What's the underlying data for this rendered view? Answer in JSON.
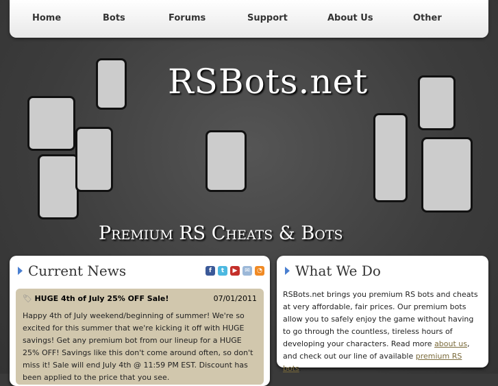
{
  "nav": [
    "Home",
    "Bots",
    "Forums",
    "Support",
    "About Us",
    "Other"
  ],
  "banner": {
    "logo": "RSBots.net",
    "tagline": "Premium RS Cheats & Bots"
  },
  "news": {
    "title": "Current News",
    "social": [
      "facebook-icon",
      "twitter-icon",
      "youtube-icon",
      "email-icon",
      "rss-icon"
    ],
    "item": {
      "title": "HUGE 4th of July 25% OFF Sale!",
      "date": "07/01/2011",
      "body": "Happy 4th of July weekend/beginning of summer! We're so excited for this summer that we're kicking it off with HUGE savings! Get any premium bot from our lineup for a HUGE 25% OFF! Savings like this don't come around often, so don't miss it! Sale will end July 4th @ 11:59 PM EST. Discount has been applied to the price that you see."
    }
  },
  "what": {
    "title": "What We Do",
    "text1": "RSBots.net brings you premium RS bots and cheats at very affordable, fair prices. Our premium bots allow you to safely enjoy the game without having to go through the countless, tireless hours of developing your characters. Read more ",
    "link1": "about us",
    "text2": ", and check out our line of available ",
    "link2": "premium RS bots",
    "text3": "."
  },
  "colors": {
    "accent": "#4a7fd0",
    "news_bg": "#d1c7ad",
    "link": "#7a6a3a"
  }
}
